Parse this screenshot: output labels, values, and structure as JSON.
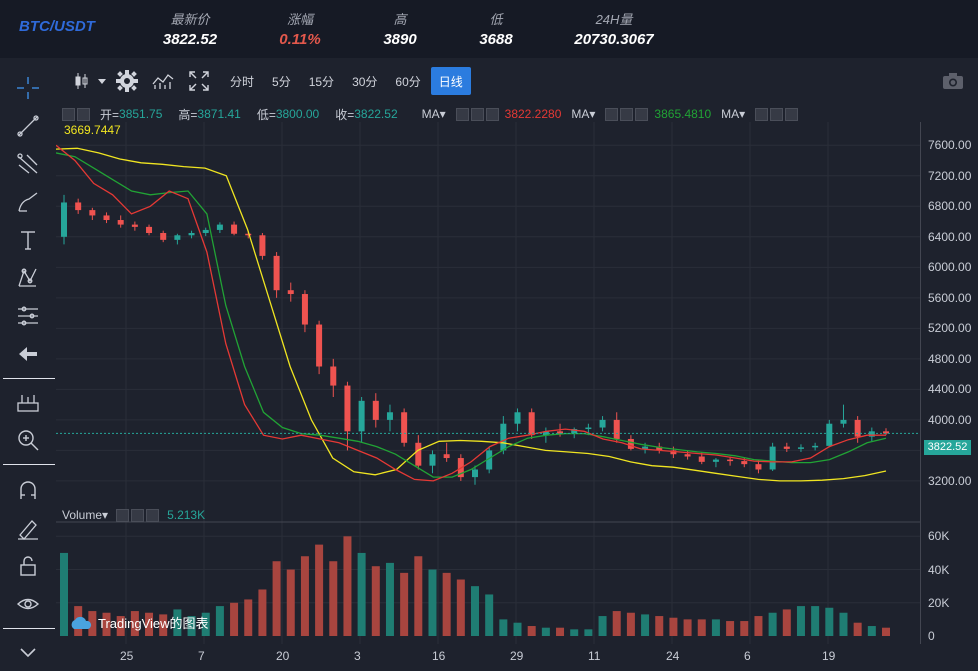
{
  "ticker": {
    "pair": "BTC/USDT",
    "stats": [
      {
        "label": "最新价",
        "value": "3822.52",
        "color": "#ffffff"
      },
      {
        "label": "涨幅",
        "value": "0.11%",
        "color": "#e2584c"
      },
      {
        "label": "高",
        "value": "3890",
        "color": "#ffffff"
      },
      {
        "label": "低",
        "value": "3688",
        "color": "#ffffff"
      },
      {
        "label": "24H量",
        "value": "20730.3067",
        "color": "#ffffff"
      }
    ]
  },
  "toolbar": {
    "intervals": [
      "分时",
      "5分",
      "15分",
      "30分",
      "60分",
      "日线"
    ],
    "active_interval": "日线",
    "icons": [
      "candles-icon",
      "chevron-down-icon",
      "gear-icon",
      "indicators-icon",
      "fullscreen-icon"
    ]
  },
  "left_tools": [
    "crosshair-icon",
    "trendline-icon",
    "fork-icon",
    "brush-icon",
    "text-icon",
    "pattern-icon",
    "fib-icon",
    "back-arrow-icon",
    "measure-icon",
    "zoom-in-icon",
    "magnet-icon",
    "lock-pen-icon",
    "unlock-icon",
    "eye-icon",
    "chevron-down-icon"
  ],
  "ohlc": {
    "open_label": "开=",
    "open": "3851.75",
    "high_label": "高=",
    "high": "3871.41",
    "low_label": "低=",
    "low": "3800.00",
    "close_label": "收=",
    "close": "3822.52"
  },
  "ma": [
    {
      "label": "MA▾",
      "value": ""
    },
    {
      "label": "MA▾",
      "value": "3822.2280",
      "color": "#e53935"
    },
    {
      "label": "MA▾",
      "value": "3865.4810",
      "color": "#21a335"
    }
  ],
  "ma_yellow_label": "3669.7447",
  "volume": {
    "label": "Volume▾",
    "value": "5.213K"
  },
  "watermark": "TradingView的图表",
  "last_price": "3822.52",
  "colors": {
    "up": "#26a69a",
    "down": "#ef5350",
    "ma1": "#e53935",
    "ma2": "#21a335",
    "ma3": "#f0e521",
    "accent": "#2b7cdf"
  },
  "chart_data": {
    "type": "candlestick",
    "price_ticks": [
      "7600.00",
      "7200.00",
      "6800.00",
      "6400.00",
      "6000.00",
      "5600.00",
      "5200.00",
      "4800.00",
      "4400.00",
      "4000.00",
      "3600.00",
      "3200.00"
    ],
    "volume_ticks": [
      "60K",
      "40K",
      "20K",
      "0"
    ],
    "x_ticks": [
      "25",
      "7",
      "20",
      "3",
      "16",
      "29",
      "11",
      "24",
      "6",
      "19"
    ],
    "ylim": [
      2950,
      7800
    ],
    "vol_ylim": [
      0,
      65000
    ],
    "candles": [
      [
        6400,
        6950,
        6300,
        6850
      ],
      [
        6850,
        6900,
        6700,
        6750
      ],
      [
        6750,
        6780,
        6620,
        6680
      ],
      [
        6680,
        6720,
        6580,
        6620
      ],
      [
        6620,
        6680,
        6520,
        6560
      ],
      [
        6560,
        6600,
        6480,
        6530
      ],
      [
        6530,
        6560,
        6420,
        6450
      ],
      [
        6450,
        6480,
        6330,
        6360
      ],
      [
        6360,
        6440,
        6300,
        6420
      ],
      [
        6420,
        6480,
        6380,
        6450
      ],
      [
        6450,
        6520,
        6410,
        6490
      ],
      [
        6490,
        6590,
        6450,
        6560
      ],
      [
        6560,
        6600,
        6420,
        6440
      ],
      [
        6440,
        6480,
        6380,
        6420
      ],
      [
        6420,
        6450,
        6100,
        6150
      ],
      [
        6150,
        6200,
        5600,
        5700
      ],
      [
        5700,
        5800,
        5550,
        5650
      ],
      [
        5650,
        5700,
        5150,
        5250
      ],
      [
        5250,
        5300,
        4600,
        4700
      ],
      [
        4700,
        4800,
        4300,
        4450
      ],
      [
        4450,
        4500,
        3600,
        3850
      ],
      [
        3850,
        4300,
        3700,
        4250
      ],
      [
        4250,
        4350,
        3900,
        4000
      ],
      [
        4000,
        4200,
        3850,
        4100
      ],
      [
        4100,
        4150,
        3650,
        3700
      ],
      [
        3700,
        3800,
        3350,
        3400
      ],
      [
        3400,
        3600,
        3300,
        3550
      ],
      [
        3550,
        3700,
        3450,
        3500
      ],
      [
        3500,
        3550,
        3200,
        3250
      ],
      [
        3250,
        3400,
        3150,
        3350
      ],
      [
        3350,
        3650,
        3300,
        3600
      ],
      [
        3600,
        4050,
        3550,
        3950
      ],
      [
        3950,
        4150,
        3850,
        4100
      ],
      [
        4100,
        4150,
        3750,
        3800
      ],
      [
        3800,
        3900,
        3700,
        3850
      ],
      [
        3850,
        3950,
        3780,
        3820
      ],
      [
        3820,
        3900,
        3760,
        3880
      ],
      [
        3880,
        3950,
        3800,
        3900
      ],
      [
        3900,
        4050,
        3850,
        4000
      ],
      [
        4000,
        4100,
        3700,
        3750
      ],
      [
        3750,
        3800,
        3600,
        3620
      ],
      [
        3620,
        3700,
        3560,
        3650
      ],
      [
        3650,
        3700,
        3560,
        3600
      ],
      [
        3600,
        3650,
        3500,
        3550
      ],
      [
        3550,
        3600,
        3480,
        3520
      ],
      [
        3520,
        3580,
        3420,
        3450
      ],
      [
        3450,
        3500,
        3380,
        3480
      ],
      [
        3480,
        3520,
        3400,
        3460
      ],
      [
        3460,
        3500,
        3380,
        3420
      ],
      [
        3420,
        3480,
        3300,
        3350
      ],
      [
        3350,
        3700,
        3330,
        3650
      ],
      [
        3650,
        3700,
        3580,
        3620
      ],
      [
        3620,
        3680,
        3580,
        3640
      ],
      [
        3640,
        3700,
        3600,
        3660
      ],
      [
        3660,
        4000,
        3640,
        3950
      ],
      [
        3950,
        4200,
        3900,
        4000
      ],
      [
        4000,
        4050,
        3700,
        3780
      ],
      [
        3780,
        3900,
        3720,
        3850
      ],
      [
        3850,
        3890,
        3800,
        3822
      ]
    ],
    "volumes": [
      50,
      18,
      15,
      14,
      12,
      15,
      14,
      13,
      16,
      12,
      14,
      18,
      20,
      22,
      28,
      45,
      40,
      48,
      55,
      45,
      60,
      50,
      42,
      44,
      38,
      48,
      40,
      38,
      34,
      30,
      25,
      10,
      8,
      6,
      5,
      5,
      4,
      4,
      12,
      15,
      14,
      13,
      12,
      11,
      10,
      10,
      10,
      9,
      9,
      12,
      14,
      16,
      18,
      18,
      17,
      14,
      8,
      6,
      5
    ],
    "ma_red": [
      7600,
      7400,
      7100,
      6950,
      6700,
      6800,
      7000,
      6900,
      6200,
      5000,
      4200,
      3800,
      3750,
      3800,
      3750,
      3700,
      3600,
      3500,
      3350,
      3220,
      3200,
      3300,
      3450,
      3650,
      3760,
      3800,
      3850,
      3880,
      3850,
      3750,
      3700,
      3620,
      3600,
      3580,
      3560,
      3540,
      3500,
      3460,
      3450,
      3450,
      3500,
      3650,
      3740,
      3800,
      3800
    ],
    "ma_green": [
      7500,
      7450,
      7300,
      7150,
      7000,
      6950,
      6980,
      7000,
      6700,
      5500,
      4700,
      4100,
      3900,
      3820,
      3800,
      3760,
      3720,
      3650,
      3550,
      3400,
      3250,
      3250,
      3350,
      3500,
      3650,
      3760,
      3800,
      3820,
      3820,
      3780,
      3730,
      3680,
      3640,
      3610,
      3580,
      3560,
      3530,
      3480,
      3460,
      3440,
      3440,
      3480,
      3580,
      3700,
      3760
    ],
    "ma_yellow": [
      7550,
      7560,
      7500,
      7420,
      7370,
      7350,
      7320,
      7300,
      7200,
      6500,
      5600,
      4700,
      4000,
      3500,
      3320,
      3280,
      3350,
      3600,
      3720,
      3730,
      3720,
      3700,
      3650,
      3600,
      3580,
      3560,
      3520,
      3450,
      3400,
      3380,
      3340,
      3300,
      3260,
      3220,
      3200,
      3200,
      3210,
      3230,
      3270,
      3330
    ]
  }
}
